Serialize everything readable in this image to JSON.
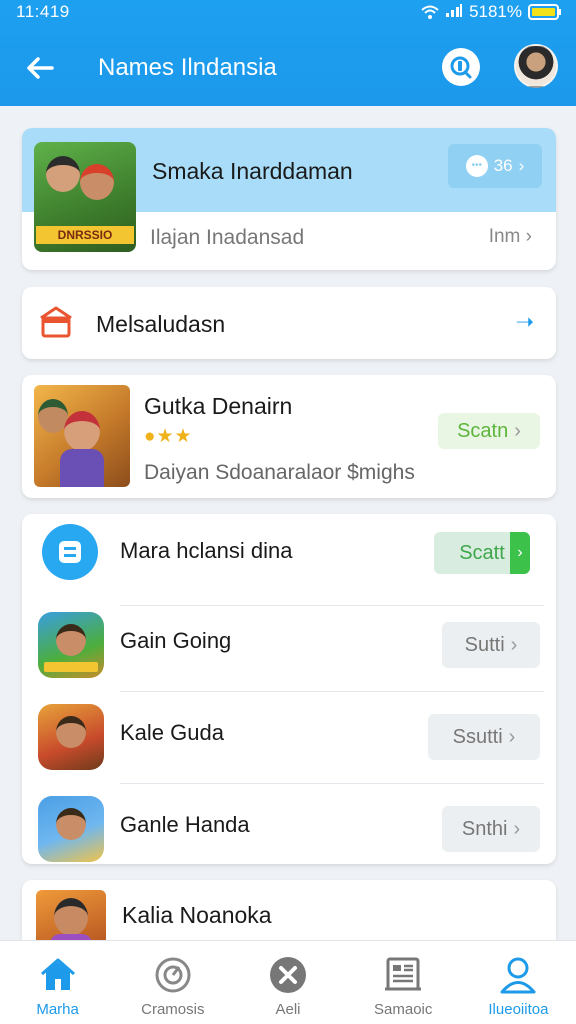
{
  "status": {
    "time": "11:419",
    "battery": "5181%"
  },
  "appbar": {
    "title": "Names Ilndansia"
  },
  "card_featured": {
    "thumb_caption": "DNRSSIO",
    "name": "Smaka Inarddaman",
    "pill_count": "36",
    "sub": "Ilajan Inadansad",
    "more": "Inm"
  },
  "card_menu": {
    "label": "Melsaludasn"
  },
  "card_game": {
    "name": "Gutka Denairn",
    "sub": "Daiyan Sdoanaralaor $mighs",
    "button": "Scatn"
  },
  "list": [
    {
      "label": "Mara hclansi dina",
      "button": "Scatt"
    },
    {
      "label": "Gain Going",
      "button": "Sutti"
    },
    {
      "label": "Kale Guda",
      "button": "Ssutti"
    },
    {
      "label": "Ganle Handa",
      "button": "Snthi"
    }
  ],
  "card_partial": {
    "name": "Kalia Noanoka"
  },
  "nav": [
    {
      "label": "Marha",
      "icon": "home-icon",
      "active": true
    },
    {
      "label": "Cramosis",
      "icon": "compass-icon",
      "active": false
    },
    {
      "label": "Aeli",
      "icon": "close-circle-icon",
      "active": false
    },
    {
      "label": "Samaoic",
      "icon": "news-icon",
      "active": false
    },
    {
      "label": "Ilueoiitoa",
      "icon": "profile-icon",
      "active": true
    }
  ],
  "colors": {
    "primary": "#1d9aea",
    "header": "#1ea0f0",
    "accent_green": "#3cc24a",
    "background": "#eef1f5"
  }
}
